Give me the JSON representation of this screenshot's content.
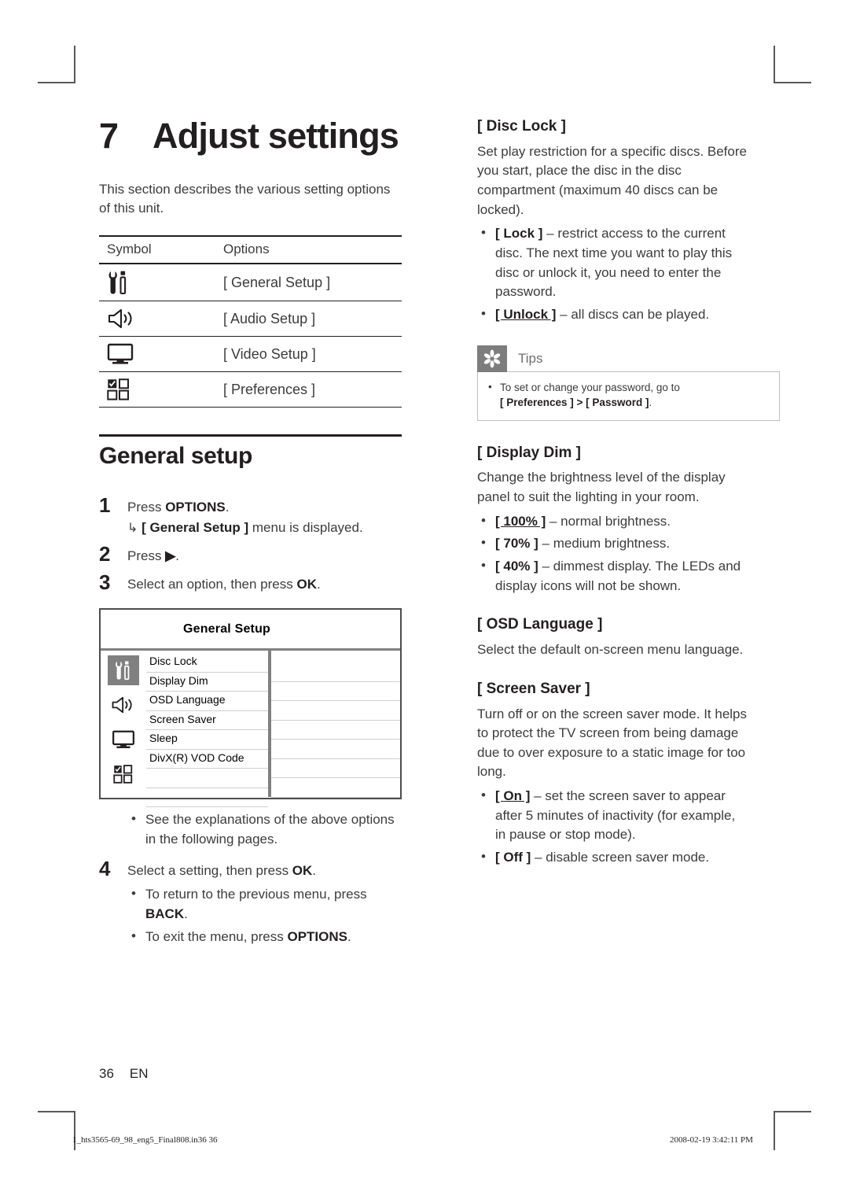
{
  "chapter": {
    "number": "7",
    "title": "Adjust settings",
    "intro": "This section describes the various setting options of this unit."
  },
  "symbol_table": {
    "headers": [
      "Symbol",
      "Options"
    ],
    "rows": [
      {
        "icon": "tools-wrench-screwdriver-icon",
        "option": "[ General Setup ]"
      },
      {
        "icon": "speaker-audio-icon",
        "option": "[ Audio Setup ]"
      },
      {
        "icon": "monitor-video-icon",
        "option": "[ Video Setup ]"
      },
      {
        "icon": "checkbox-grid-preferences-icon",
        "option": "[ Preferences ]"
      }
    ]
  },
  "general_setup": {
    "heading": "General setup",
    "steps": [
      {
        "num": "1",
        "text_before": "Press ",
        "key": "OPTIONS",
        "text_after": ".",
        "sub_arrow": "↳",
        "sub_bold": "[ General Setup ]",
        "sub_rest": " menu is displayed."
      },
      {
        "num": "2",
        "text_before": "Press ",
        "key": "▶",
        "text_after": "."
      },
      {
        "num": "3",
        "text_before": "Select an option, then press ",
        "key": "OK",
        "text_after": "."
      }
    ],
    "after_menu_bullets": [
      "See the explanations of the above options in the following pages."
    ],
    "step4": {
      "num": "4",
      "text_before": "Select a setting, then press ",
      "key": "OK",
      "text_after": ".",
      "bullets": [
        {
          "pre": "To return to the previous menu, press ",
          "key": "BACK",
          "post": "."
        },
        {
          "pre": "To exit the menu, press ",
          "key": "OPTIONS",
          "post": "."
        }
      ]
    }
  },
  "osd_menu": {
    "title": "General Setup",
    "rail_icons": [
      {
        "name": "tools-wrench-screwdriver-icon",
        "selected": true
      },
      {
        "name": "speaker-audio-icon",
        "selected": false
      },
      {
        "name": "monitor-video-icon",
        "selected": false
      },
      {
        "name": "checkbox-grid-preferences-icon",
        "selected": false
      }
    ],
    "items": [
      "Disc Lock",
      "Display Dim",
      "OSD Language",
      "Screen Saver",
      "Sleep",
      "DivX(R) VOD Code",
      "",
      ""
    ],
    "values": [
      "",
      "",
      "",
      "",
      "",
      "",
      "",
      ""
    ]
  },
  "right_column": {
    "disc_lock": {
      "heading": "[ Disc Lock ]",
      "paragraphs": [
        "Set play restriction for a specific discs. Before you start, place the disc in the disc compartment (maximum 40 discs can be locked)."
      ],
      "bullets": [
        {
          "label": "[ Lock ]",
          "underline": false,
          "text": " – restrict access to the current disc.  The next time you want to play this disc or unlock it, you need to enter the password."
        },
        {
          "label": "[ Unlock ]",
          "underline": true,
          "text": " – all discs can be played."
        }
      ]
    },
    "tips": {
      "icon": "asterisk-tip-icon",
      "label": "Tips",
      "bullet_pre": "To set or change your password, go to ",
      "bullet_bold": "[ Preferences ] > [ Password ]",
      "bullet_post": "."
    },
    "display_dim": {
      "heading": "[ Display Dim ]",
      "paragraphs": [
        "Change the brightness level of the display panel to suit the lighting in your room."
      ],
      "bullets": [
        {
          "label": "[ 100% ]",
          "underline": true,
          "text": " – normal brightness."
        },
        {
          "label": "[ 70% ]",
          "underline": false,
          "text": " – medium brightness."
        },
        {
          "label": "[ 40% ]",
          "underline": false,
          "text": " – dimmest display. The LEDs and display icons will not be shown."
        }
      ]
    },
    "osd_language": {
      "heading": "[ OSD Language ]",
      "paragraphs": [
        "Select the default on-screen menu language."
      ]
    },
    "screen_saver": {
      "heading": "[ Screen Saver ]",
      "paragraphs": [
        "Turn off or on the screen saver mode.  It helps to protect the TV screen from being damage due to over exposure to a static image for too long."
      ],
      "bullets": [
        {
          "label": "[ On ]",
          "underline": true,
          "text": " – set the screen saver to appear after 5 minutes of inactivity (for example, in pause or stop mode)."
        },
        {
          "label": "[ Off ]",
          "underline": false,
          "text": " – disable screen saver mode."
        }
      ]
    }
  },
  "footer": {
    "page_number": "36",
    "language_code": "EN",
    "print_file": "1_hts3565-69_98_eng5_Final808.in36   36",
    "print_timestamp": "2008-02-19   3:42:11 PM"
  },
  "colors": {
    "text": "#231f20",
    "body_text": "#3c3c3c",
    "tips_gray": "#7d7d7d",
    "osd_border": "#4d4d4d",
    "osd_divider": "#808080",
    "osd_rule": "#cfcfcf"
  }
}
